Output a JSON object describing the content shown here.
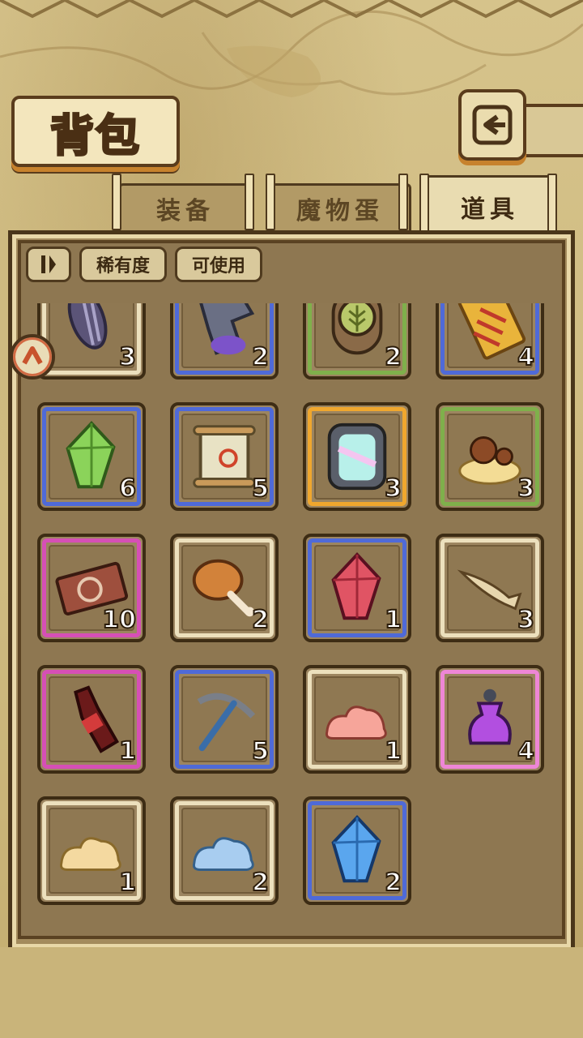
{
  "header": {
    "title": "背包"
  },
  "tabs": [
    {
      "label": "装备",
      "active": false
    },
    {
      "label": "魔物蛋",
      "active": false
    },
    {
      "label": "道具",
      "active": true
    }
  ],
  "filters": {
    "toggle_icon": "sort-toggle-icon",
    "rarity_label": "稀有度",
    "usable_label": "可使用"
  },
  "rarity_colors": {
    "common": "#ece0bd",
    "green": "#7fb04b",
    "blue": "#4f6ad8",
    "purple": "#d64fb6",
    "pink": "#ee86d6",
    "gold": "#f0a72e"
  },
  "items": [
    {
      "icon": "striped-seed",
      "rarity": "common",
      "qty": "3"
    },
    {
      "icon": "dark-dragon-figure",
      "rarity": "blue",
      "qty": "2"
    },
    {
      "icon": "leaf-emblem",
      "rarity": "green",
      "qty": "2"
    },
    {
      "icon": "sealed-talisman",
      "rarity": "blue",
      "qty": "4"
    },
    {
      "icon": "green-crystal",
      "rarity": "blue",
      "qty": "6"
    },
    {
      "icon": "treasure-scroll",
      "rarity": "blue",
      "qty": "5"
    },
    {
      "icon": "portal-gate",
      "rarity": "gold",
      "qty": "3"
    },
    {
      "icon": "mushroom-cloud",
      "rarity": "green",
      "qty": "3"
    },
    {
      "icon": "ticket-card",
      "rarity": "purple",
      "qty": "10"
    },
    {
      "icon": "drumstick",
      "rarity": "common",
      "qty": "2"
    },
    {
      "icon": "red-crystal",
      "rarity": "blue",
      "qty": "1"
    },
    {
      "icon": "fish",
      "rarity": "common",
      "qty": "3"
    },
    {
      "icon": "cola-bottle",
      "rarity": "purple",
      "qty": "1"
    },
    {
      "icon": "pickaxe",
      "rarity": "blue",
      "qty": "5"
    },
    {
      "icon": "pink-cloud",
      "rarity": "common",
      "qty": "1"
    },
    {
      "icon": "purple-potion",
      "rarity": "pink",
      "qty": "4"
    },
    {
      "icon": "yellow-cloud",
      "rarity": "common",
      "qty": "1"
    },
    {
      "icon": "blue-cloud",
      "rarity": "common",
      "qty": "2"
    },
    {
      "icon": "blue-crystal",
      "rarity": "blue",
      "qty": "2"
    }
  ]
}
